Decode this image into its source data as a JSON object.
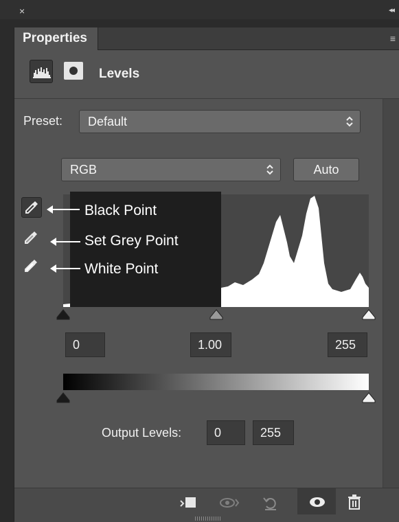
{
  "window": {
    "close_glyph": "×",
    "collapse_glyph": "◂◂"
  },
  "panel": {
    "tab_label": "Properties",
    "menu_glyph": "≡"
  },
  "header": {
    "title": "Levels",
    "icons": [
      "histogram-icon",
      "layer-mask-icon"
    ]
  },
  "preset": {
    "label": "Preset:",
    "value": "Default"
  },
  "channel": {
    "value": "RGB",
    "auto_label": "Auto"
  },
  "eyedroppers": [
    {
      "name": "black-point-eyedropper",
      "callout": "Black Point",
      "active": true
    },
    {
      "name": "grey-point-eyedropper",
      "callout": "Set Grey Point",
      "active": false
    },
    {
      "name": "white-point-eyedropper",
      "callout": "White Point",
      "active": false
    }
  ],
  "input_levels": {
    "black": "0",
    "gamma": "1.00",
    "white": "255"
  },
  "input_sliders": {
    "black": 0,
    "gamma": 0.5,
    "white": 1
  },
  "output_levels": {
    "label": "Output Levels:",
    "black": "0",
    "white": "255"
  },
  "output_sliders": {
    "black": 0,
    "white": 1
  },
  "footer_icons": [
    "clip-to-layer-icon",
    "view-previous-icon",
    "reset-icon",
    "visibility-eye-icon",
    "delete-icon"
  ],
  "colors": {
    "panel_bg": "#535353",
    "dark_bg": "#2b2b2b",
    "field_bg": "#3c3c3c",
    "highlight": "#ffffff"
  }
}
